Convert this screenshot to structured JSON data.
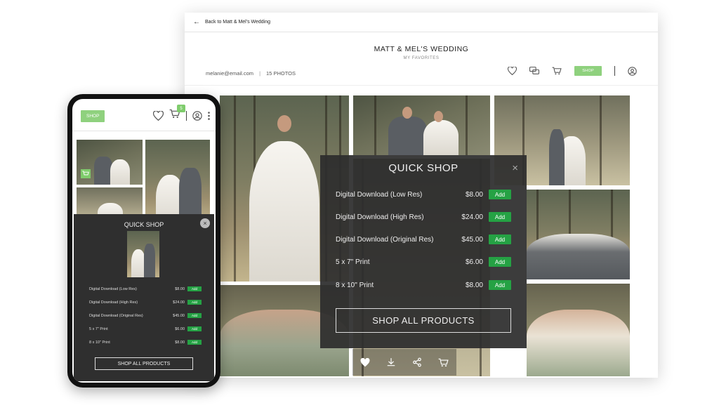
{
  "desktop": {
    "back_label": "Back to Matt & Mel's Wedding",
    "title": "MATT & MEL'S WEDDING",
    "subtitle": "MY FAVORITES",
    "email": "melanie@email.com",
    "photo_count": "15 PHOTOS",
    "meta_separator": "|",
    "shop_label": "SHOP"
  },
  "quick_shop": {
    "title": "QUICK SHOP",
    "close": "×",
    "items": [
      {
        "name": "Digital Download (Low Res)",
        "price": "$8.00",
        "add": "Add"
      },
      {
        "name": "Digital Download (High Res)",
        "price": "$24.00",
        "add": "Add"
      },
      {
        "name": "Digital Download (Original Res)",
        "price": "$45.00",
        "add": "Add"
      },
      {
        "name": "5 x 7\" Print",
        "price": "$6.00",
        "add": "Add"
      },
      {
        "name": "8 x 10\" Print",
        "price": "$8.00",
        "add": "Add"
      }
    ],
    "shop_all": "SHOP ALL PRODUCTS"
  },
  "phone": {
    "shop_label": "SHOP",
    "cart_count": "5",
    "quick_shop": {
      "title": "QUICK SHOP",
      "close": "×",
      "items": [
        {
          "name": "Digital Download (Low Res)",
          "price": "$8.00",
          "add": "Add"
        },
        {
          "name": "Digital Download (High Res)",
          "price": "$24.00",
          "add": "Add"
        },
        {
          "name": "Digital Download (Original Res)",
          "price": "$45.00",
          "add": "Add"
        },
        {
          "name": "5 x 7\" Print",
          "price": "$6.00",
          "add": "Add"
        },
        {
          "name": "8 x 10\" Print",
          "price": "$8.00",
          "add": "Add"
        }
      ],
      "shop_all": "SHOP ALL PRODUCTS"
    }
  },
  "colors": {
    "accent_green": "#8fd17e",
    "add_green": "#25a244",
    "panel_dark": "#2d2d2d"
  },
  "icons": [
    "arrow-left-icon",
    "heart-icon",
    "chat-icon",
    "cart-icon",
    "user-icon",
    "download-icon",
    "share-icon",
    "more-icon",
    "close-icon"
  ]
}
